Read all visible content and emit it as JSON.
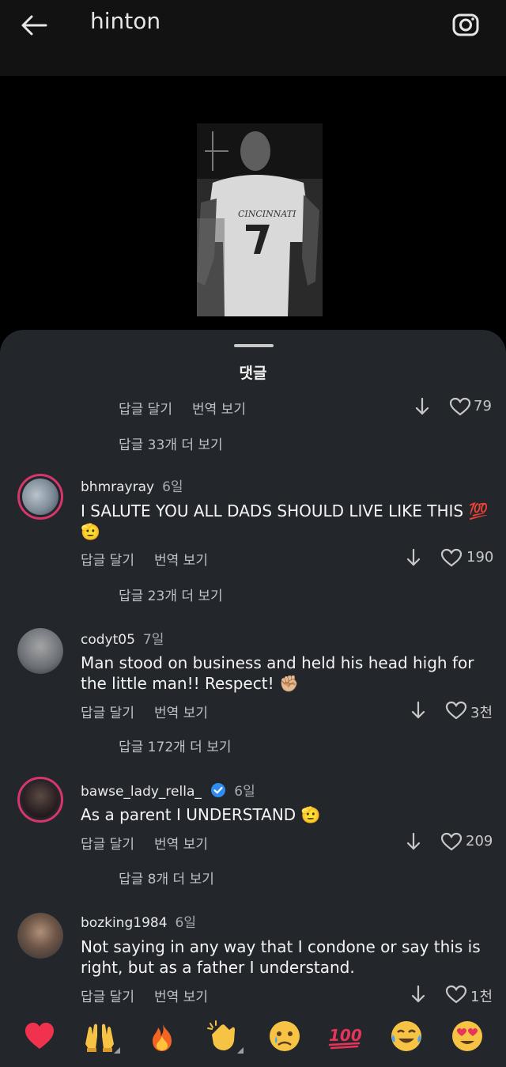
{
  "topbar": {
    "title": "hinton"
  },
  "sheet": {
    "title": "댓글"
  },
  "first": {
    "reply": "답글 달기",
    "translate": "번역 보기",
    "likes": "79",
    "more": "답글 33개 더 보기"
  },
  "comments": [
    {
      "username": "bhmrayray",
      "time": "6일",
      "text": "I SALUTE YOU ALL DADS SHOULD LIVE LIKE THIS 💯 🫡",
      "reply": "답글 달기",
      "translate": "번역 보기",
      "likes": "190",
      "more": "답글 23개 더 보기"
    },
    {
      "username": "codyt05",
      "time": "7일",
      "text": "Man stood on business and held his head high for the little man!! Respect! ✊🏼",
      "reply": "답글 달기",
      "translate": "번역 보기",
      "likes": "3천",
      "more": "답글 172개 더 보기"
    },
    {
      "username": "bawse_lady_rella_",
      "time": "6일",
      "text": "As a parent I UNDERSTAND 🫡",
      "reply": "답글 달기",
      "translate": "번역 보기",
      "likes": "209",
      "more": "답글 8개 더 보기"
    },
    {
      "username": "bozking1984",
      "time": "6일",
      "text": "Not saying in any way that I condone or say this is right, but as a father I understand.",
      "reply": "답글 달기",
      "translate": "번역 보기",
      "likes": "1천"
    }
  ],
  "emoji_bar": [
    "red-heart",
    "raising-hands",
    "fire",
    "clapping-hands",
    "crying-face",
    "hundred-points",
    "tears-of-joy",
    "heart-eyes"
  ],
  "colors": {
    "sheet": "#23262b",
    "ring": "#d8356b",
    "verified": "#2f8cf0",
    "hundred": "#e8335a"
  }
}
